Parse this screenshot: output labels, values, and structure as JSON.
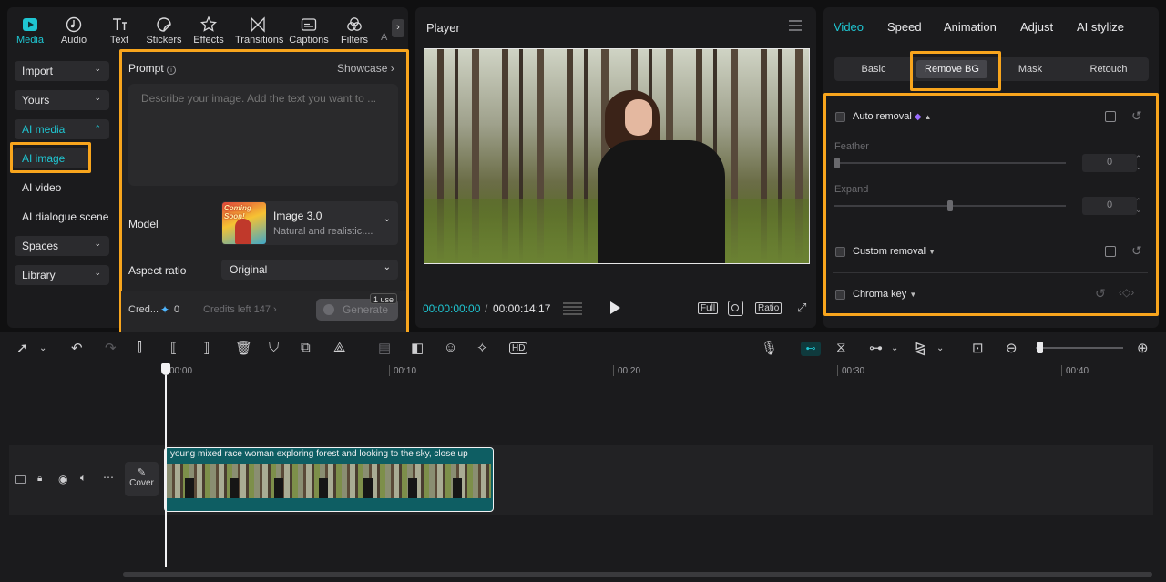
{
  "tabs": [
    {
      "label": "Media",
      "icon": "media-icon",
      "active": true
    },
    {
      "label": "Audio",
      "icon": "audio-icon"
    },
    {
      "label": "Text",
      "icon": "text-icon"
    },
    {
      "label": "Stickers",
      "icon": "stickers-icon"
    },
    {
      "label": "Effects",
      "icon": "effects-icon"
    },
    {
      "label": "Transitions",
      "icon": "transitions-icon"
    },
    {
      "label": "Captions",
      "icon": "captions-icon"
    },
    {
      "label": "Filters",
      "icon": "filters-icon"
    },
    {
      "label": "A",
      "icon": "more-icon"
    }
  ],
  "sidebar": {
    "import": "Import",
    "yours": "Yours",
    "ai_media": "AI media",
    "ai_image": "AI image",
    "ai_video": "AI video",
    "ai_dialogue": "AI dialogue scene",
    "spaces": "Spaces",
    "library": "Library"
  },
  "prompt": {
    "label": "Prompt",
    "showcase": "Showcase",
    "placeholder": "Describe your image. Add the text you want to ..."
  },
  "model": {
    "label": "Model",
    "name": "Image 3.0",
    "desc": "Natural and realistic....",
    "thumb_text": "Coming Soon!"
  },
  "aspect": {
    "label": "Aspect ratio",
    "value": "Original"
  },
  "credits": {
    "label": "Cred...",
    "value": "0",
    "left": "Credits left 147",
    "use_badge": "1 use",
    "generate": "Generate"
  },
  "player": {
    "title": "Player",
    "current_time": "00:00:00:00",
    "separator": "/",
    "total_time": "00:00:14:17",
    "full": "Full",
    "ratio": "Ratio"
  },
  "right_tabs": [
    "Video",
    "Speed",
    "Animation",
    "Adjust",
    "AI stylize"
  ],
  "segments": [
    "Basic",
    "Remove BG",
    "Mask",
    "Retouch"
  ],
  "remove_bg": {
    "auto": "Auto removal",
    "feather": "Feather",
    "feather_val": "0",
    "expand": "Expand",
    "expand_val": "0",
    "custom": "Custom removal",
    "chroma": "Chroma key"
  },
  "timeline": {
    "ticks": [
      "00:00",
      "00:10",
      "00:20",
      "00:30",
      "00:40"
    ],
    "cover": "Cover",
    "clip_title": "young mixed race woman exploring forest and looking to the sky, close up"
  },
  "colors": {
    "accent": "#1fc6d2",
    "highlight": "#f8a51d",
    "clip_teal": "#0e5e63"
  }
}
